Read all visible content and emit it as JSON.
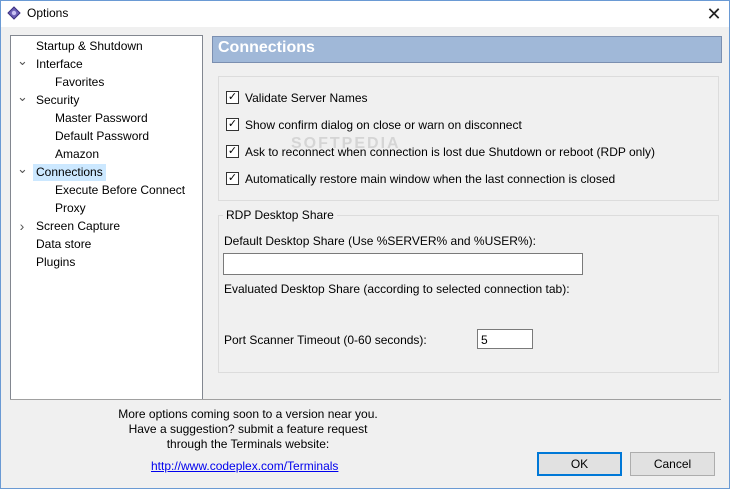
{
  "window": {
    "title": "Options"
  },
  "tree": {
    "items": [
      {
        "label": "Startup & Shutdown",
        "expander": ""
      },
      {
        "label": "Interface",
        "expander": "expanded"
      },
      {
        "label": "Favorites",
        "expander": ""
      },
      {
        "label": "Security",
        "expander": "expanded"
      },
      {
        "label": "Master Password",
        "expander": ""
      },
      {
        "label": "Default Password",
        "expander": ""
      },
      {
        "label": "Amazon",
        "expander": ""
      },
      {
        "label": "Connections",
        "expander": "expanded",
        "selected": true
      },
      {
        "label": "Execute Before Connect",
        "expander": ""
      },
      {
        "label": "Proxy",
        "expander": ""
      },
      {
        "label": "Screen Capture",
        "expander": "collapsed"
      },
      {
        "label": "Data store",
        "expander": ""
      },
      {
        "label": "Plugins",
        "expander": ""
      }
    ]
  },
  "panel": {
    "title": "Connections",
    "checkboxes": [
      {
        "label": "Validate Server Names",
        "checked": true
      },
      {
        "label": "Show confirm dialog on close or warn on disconnect",
        "checked": true
      },
      {
        "label": "Ask to reconnect when connection is lost due Shutdown or reboot (RDP only)",
        "checked": true
      },
      {
        "label": "Automatically restore main window when the last connection is closed",
        "checked": true
      }
    ],
    "rdp_group": {
      "title": "RDP Desktop Share",
      "default_share_label": "Default Desktop Share (Use %SERVER% and %USER%):",
      "default_share_value": "",
      "evaluated_share_label": "Evaluated Desktop Share (according to selected connection tab):",
      "port_timeout_label": "Port Scanner Timeout (0-60 seconds):",
      "port_timeout_value": "5"
    }
  },
  "footer": {
    "info_line1": "More options coming soon to a version near you.",
    "info_line2": "Have a suggestion? submit a feature request",
    "info_line3": "through the Terminals website:",
    "link": "http://www.codeplex.com/Terminals",
    "ok_label": "OK",
    "cancel_label": "Cancel"
  },
  "watermark": "SOFTPEDIA"
}
